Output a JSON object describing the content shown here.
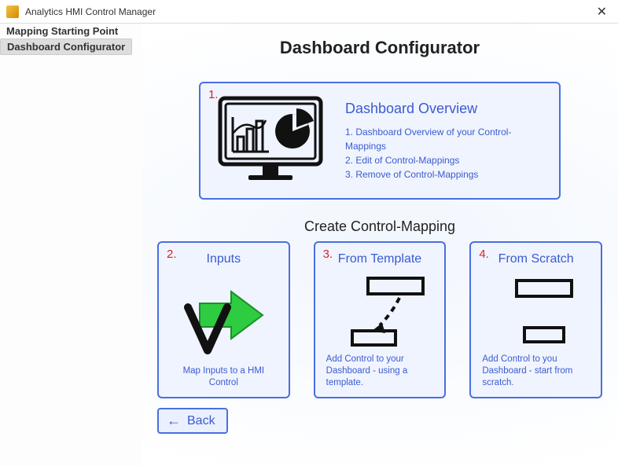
{
  "window": {
    "title": "Analytics HMI Control Manager",
    "close": "✕"
  },
  "sidebar": {
    "items": [
      {
        "label": "Mapping Starting Point",
        "active": false
      },
      {
        "label": "Dashboard Configurator",
        "active": true
      }
    ]
  },
  "header": {
    "title": "Dashboard Configurator"
  },
  "overview": {
    "num": "1.",
    "title": "Dashboard Overview",
    "lines": [
      "1. Dashboard Overview of your Control-Mappings",
      "2. Edit of Control-Mappings",
      "3. Remove of Control-Mappings"
    ]
  },
  "create": {
    "section_title": "Create Control-Mapping",
    "cards": [
      {
        "num": "2.",
        "title": "Inputs",
        "desc": "Map Inputs to a HMI Control"
      },
      {
        "num": "3.",
        "title": "From Template",
        "desc": "Add Control to your Dashboard - using a template."
      },
      {
        "num": "4.",
        "title": "From Scratch",
        "desc": "Add Control to you Dashboard - start from scratch."
      }
    ]
  },
  "back": {
    "label": "Back",
    "arrow": "←"
  }
}
